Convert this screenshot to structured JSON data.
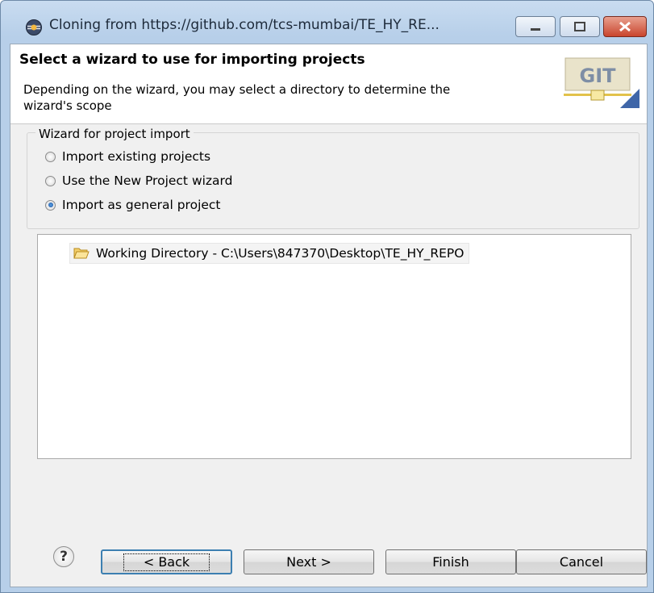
{
  "window": {
    "title": "Cloning from https://github.com/tcs-mumbai/TE_HY_RE...",
    "app_icon": "eclipse-icon",
    "controls": {
      "minimize": "minimize-icon",
      "maximize": "maximize-icon",
      "close": "close-icon"
    }
  },
  "header": {
    "title": "Select a wizard to use for importing projects",
    "description": "Depending on the wizard, you may select a directory to determine the wizard's scope",
    "banner_text": "GIT"
  },
  "wizard_group": {
    "legend": "Wizard for project import",
    "options": [
      {
        "label": "Import existing projects",
        "mnemonic": "e",
        "selected": false
      },
      {
        "label": "Use the New Project wizard",
        "mnemonic": "P",
        "selected": false
      },
      {
        "label": "Import as general project",
        "mnemonic": "g",
        "selected": true
      }
    ]
  },
  "tree": {
    "items": [
      {
        "icon": "folder-open-icon",
        "label": "Working Directory - C:\\Users\\847370\\Desktop\\TE_HY_REPO"
      }
    ]
  },
  "buttons": {
    "help_icon": "help-icon",
    "back": "< Back",
    "next": "Next >",
    "finish": "Finish",
    "cancel": "Cancel"
  },
  "colors": {
    "title_gradient": "#b7cfe9",
    "close_button": "#c9452d",
    "default_button_border": "#3c7fb1"
  }
}
